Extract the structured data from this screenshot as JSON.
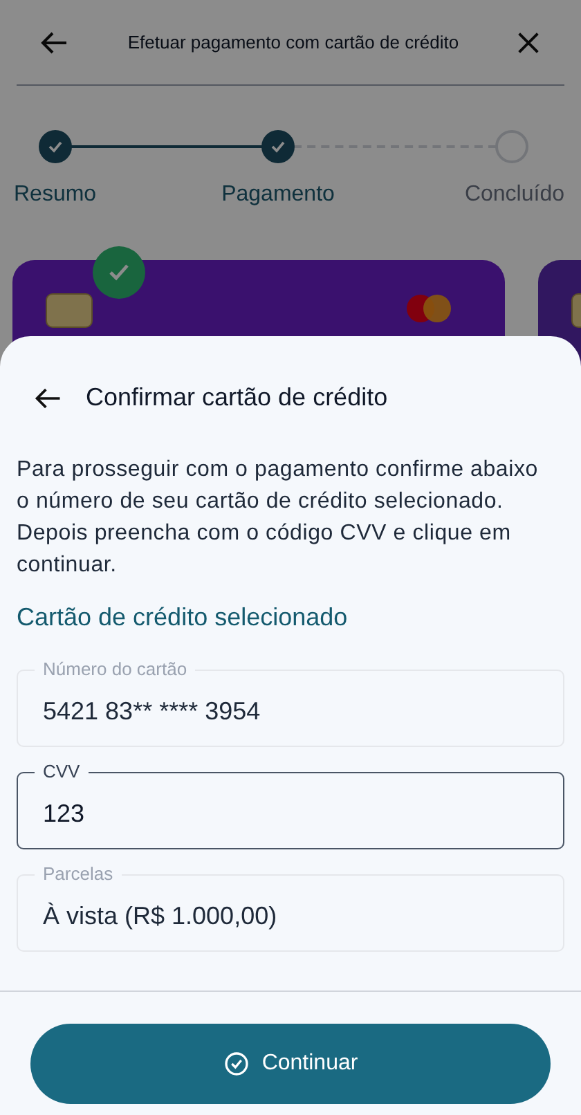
{
  "header": {
    "title": "Efetuar pagamento com cartão de crédito"
  },
  "steps": [
    {
      "label": "Resumo",
      "done": true
    },
    {
      "label": "Pagamento",
      "done": true
    },
    {
      "label": "Concluído",
      "done": false
    }
  ],
  "cards": [
    {
      "selected": true
    },
    {
      "selected": false
    }
  ],
  "sheet": {
    "title": "Confirmar cartão de crédito",
    "description": "Para prosseguir com o pagamento confirme abaixo o número de seu cartão de crédito selecionado. Depois preencha com o código CVV e clique em continuar.",
    "section_title": "Cartão de crédito selecionado",
    "fields": [
      {
        "label": "Número do cartão",
        "value": "5421 83** **** 3954",
        "disabled": true
      },
      {
        "label": "CVV",
        "value": "123",
        "disabled": false
      },
      {
        "label": "Parcelas",
        "value": "À vista (R$ 1.000,00)",
        "disabled": true
      }
    ],
    "button": "Continuar"
  }
}
